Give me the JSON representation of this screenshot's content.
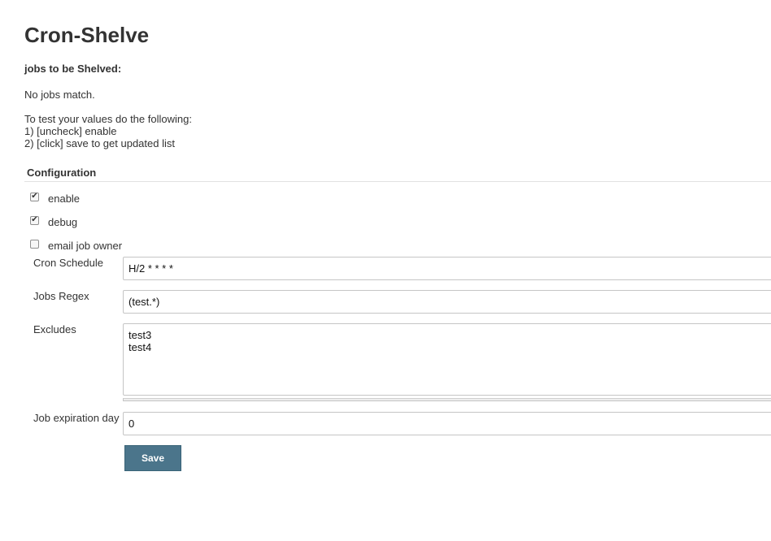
{
  "page": {
    "title": "Cron-Shelve",
    "subtitle": "jobs to be Shelved:",
    "no_jobs": "No jobs match.",
    "instructions": [
      "To test your values do the following:",
      "1) [uncheck] enable",
      "2) [click] save to get updated list"
    ]
  },
  "config": {
    "section_label": "Configuration",
    "checkboxes": {
      "enable": {
        "label": "enable",
        "checked": true,
        "mark": "✔"
      },
      "debug": {
        "label": "debug",
        "checked": true,
        "mark": "✔"
      },
      "email_owner": {
        "label": "email job owner",
        "checked": false,
        "mark": ""
      }
    },
    "fields": {
      "cron_schedule": {
        "label": "Cron Schedule",
        "value": "H/2 * * * *"
      },
      "jobs_regex": {
        "label": "Jobs Regex",
        "value": "(test.*)"
      },
      "excludes": {
        "label": "Excludes",
        "value": "test3\ntest4"
      },
      "job_expiration": {
        "label": "Job expiration day",
        "value": "0"
      }
    },
    "save_label": "Save"
  },
  "colors": {
    "button_bg": "#4b758b",
    "text": "#333333",
    "border": "#c5c5c5"
  }
}
